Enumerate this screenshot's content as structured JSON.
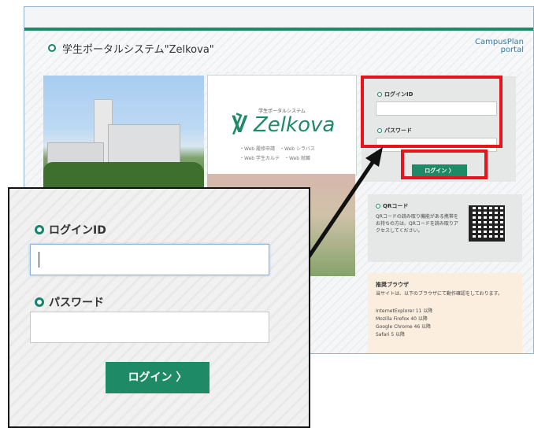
{
  "portal": {
    "system_title": "学生ポータルシステム\"Zelkova\"",
    "brand_line1": "CampusPlan",
    "brand_line2": "portal",
    "logo": {
      "subtitle": "学生ポータルシステム",
      "name": "Zelkova",
      "menu_line1": "・Web 履修申請　・Web シラバス",
      "menu_line2": "・Web 学生カルテ　・Web 就職"
    },
    "login": {
      "id_label": "ログインID",
      "password_label": "パスワード",
      "button_label": "ログイン 〉"
    },
    "qr": {
      "heading": "QRコード",
      "description": "QRコードの読み取り機能がある携帯をお持ちの方は、QRコードを読み取りアクセスしてください。"
    },
    "browser": {
      "heading": "推奨ブラウザ",
      "description": "当サイトは、以下のブラウザにて動作確認をしております。",
      "list": [
        "InternetExplorer 11 以降",
        "Mozilla Firefox 40 以降",
        "Google Chrome 46 以降",
        "Safari 5 以降"
      ]
    }
  },
  "zoom": {
    "id_label": "ログインID",
    "id_value": "",
    "password_label": "パスワード",
    "password_value": "",
    "button_label": "ログイン 〉"
  },
  "colors": {
    "accent_green": "#1f8a66",
    "highlight_red": "#e8141d"
  }
}
